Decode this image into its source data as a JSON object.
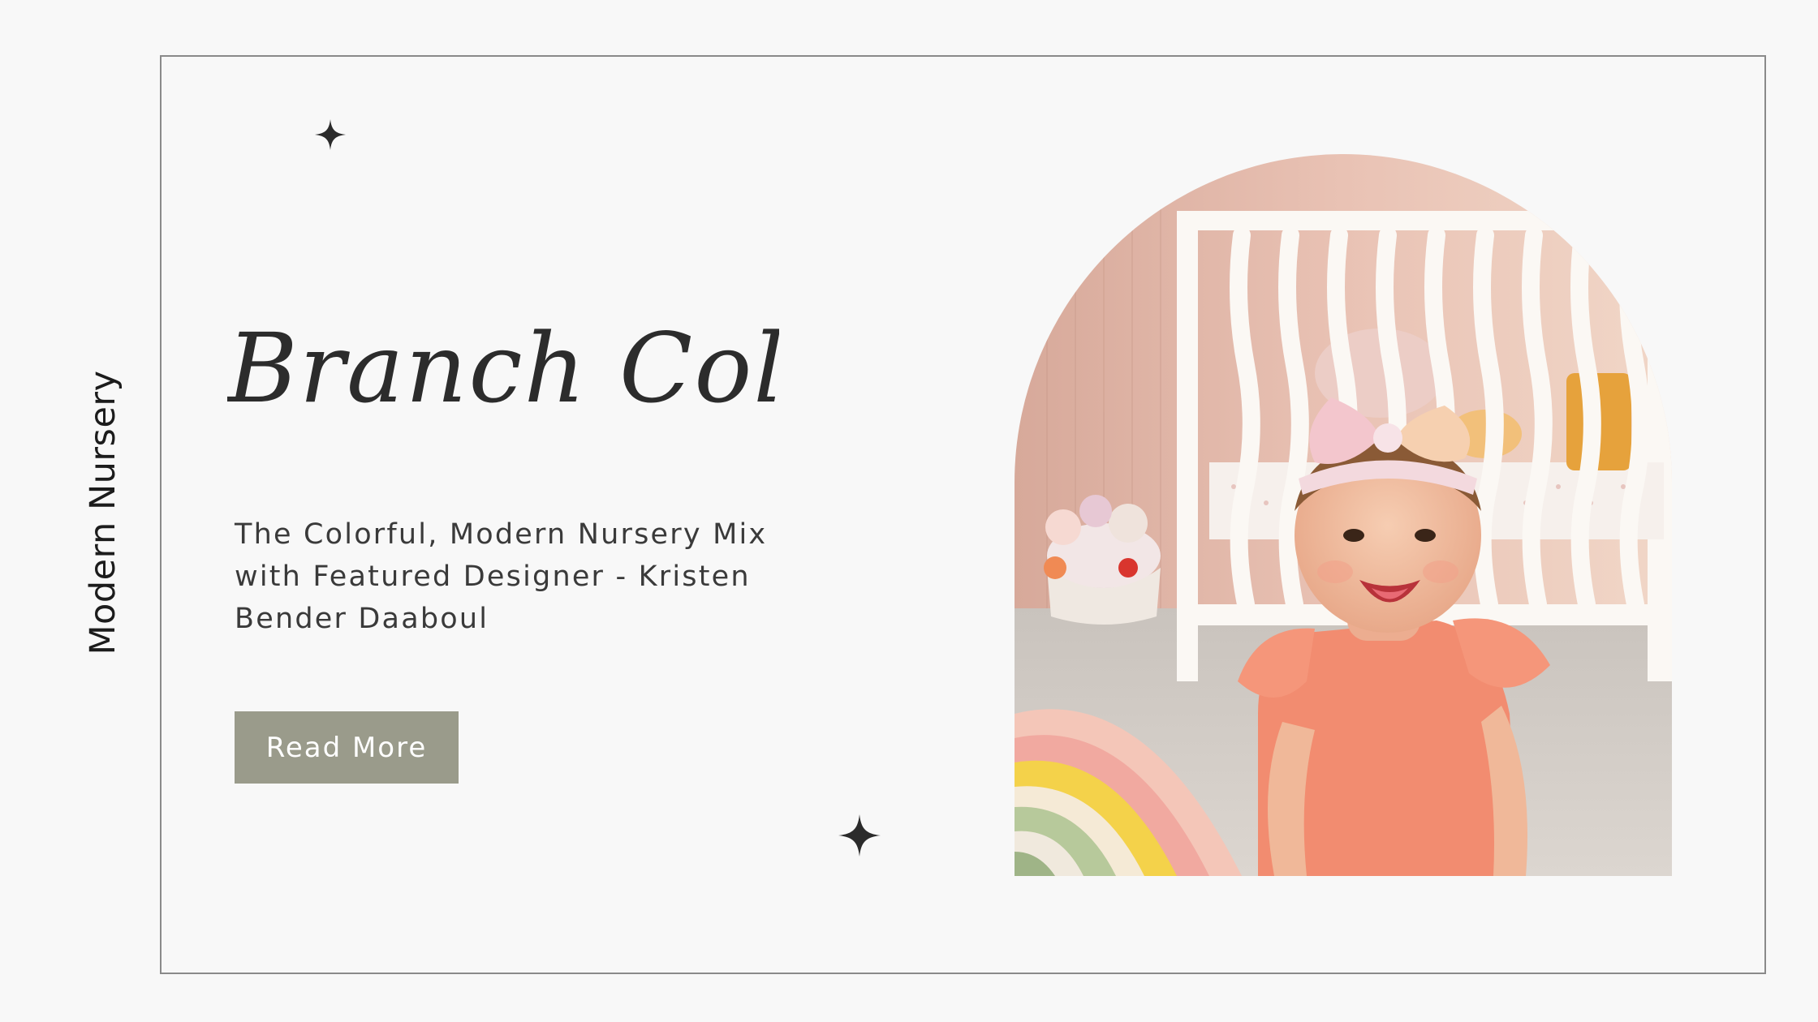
{
  "side_label": "Modern Nursery",
  "hero": {
    "title": "Branch Collection",
    "subtitle": "The Colorful, Modern Nursery Mix with Featured Designer - Kristen Bender Daaboul",
    "cta_label": "Read More"
  },
  "icons": {
    "sparkle_top": "sparkle-icon",
    "sparkle_bottom": "sparkle-icon"
  },
  "colors": {
    "background": "#f8f8f8",
    "frame_border": "#8a8a8a",
    "button_bg": "#9a9b8b",
    "button_text": "#ffffff",
    "text": "#3a3a3a"
  }
}
